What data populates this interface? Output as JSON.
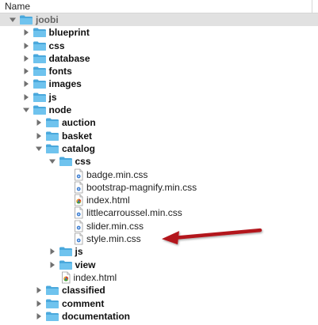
{
  "header": {
    "column_name": "Name"
  },
  "tree": [
    {
      "name": "joobi",
      "type": "folder",
      "depth": 0,
      "state": "expanded",
      "selected": true
    },
    {
      "name": "blueprint",
      "type": "folder",
      "depth": 1,
      "state": "collapsed"
    },
    {
      "name": "css",
      "type": "folder",
      "depth": 1,
      "state": "collapsed"
    },
    {
      "name": "database",
      "type": "folder",
      "depth": 1,
      "state": "collapsed"
    },
    {
      "name": "fonts",
      "type": "folder",
      "depth": 1,
      "state": "collapsed"
    },
    {
      "name": "images",
      "type": "folder",
      "depth": 1,
      "state": "collapsed"
    },
    {
      "name": "js",
      "type": "folder",
      "depth": 1,
      "state": "collapsed"
    },
    {
      "name": "node",
      "type": "folder",
      "depth": 1,
      "state": "expanded"
    },
    {
      "name": "auction",
      "type": "folder",
      "depth": 2,
      "state": "collapsed"
    },
    {
      "name": "basket",
      "type": "folder",
      "depth": 2,
      "state": "collapsed"
    },
    {
      "name": "catalog",
      "type": "folder",
      "depth": 2,
      "state": "expanded"
    },
    {
      "name": "css",
      "type": "folder",
      "depth": 3,
      "state": "expanded"
    },
    {
      "name": "badge.min.css",
      "type": "css",
      "depth": 4
    },
    {
      "name": "bootstrap-magnify.min.css",
      "type": "css",
      "depth": 4
    },
    {
      "name": "index.html",
      "type": "html",
      "depth": 4
    },
    {
      "name": "littlecarroussel.min.css",
      "type": "css",
      "depth": 4
    },
    {
      "name": "slider.min.css",
      "type": "css",
      "depth": 4
    },
    {
      "name": "style.min.css",
      "type": "css",
      "depth": 4,
      "annotated": true
    },
    {
      "name": "js",
      "type": "folder",
      "depth": 3,
      "state": "collapsed"
    },
    {
      "name": "view",
      "type": "folder",
      "depth": 3,
      "state": "collapsed"
    },
    {
      "name": "index.html",
      "type": "html",
      "depth": 3
    },
    {
      "name": "classified",
      "type": "folder",
      "depth": 2,
      "state": "collapsed"
    },
    {
      "name": "comment",
      "type": "folder",
      "depth": 2,
      "state": "collapsed"
    },
    {
      "name": "documentation",
      "type": "folder",
      "depth": 2,
      "state": "collapsed"
    }
  ],
  "colors": {
    "folder": "#6fc3ee",
    "folder_dark": "#4aa8dc",
    "annotation_arrow": "#b3141b",
    "selection": "#e1e1e1"
  },
  "icons": {
    "folder": "folder-icon",
    "css_file": "css-file-icon",
    "html_file": "html-file-icon",
    "disclosure_expanded": "disclosure-expanded-icon",
    "disclosure_collapsed": "disclosure-collapsed-icon"
  }
}
